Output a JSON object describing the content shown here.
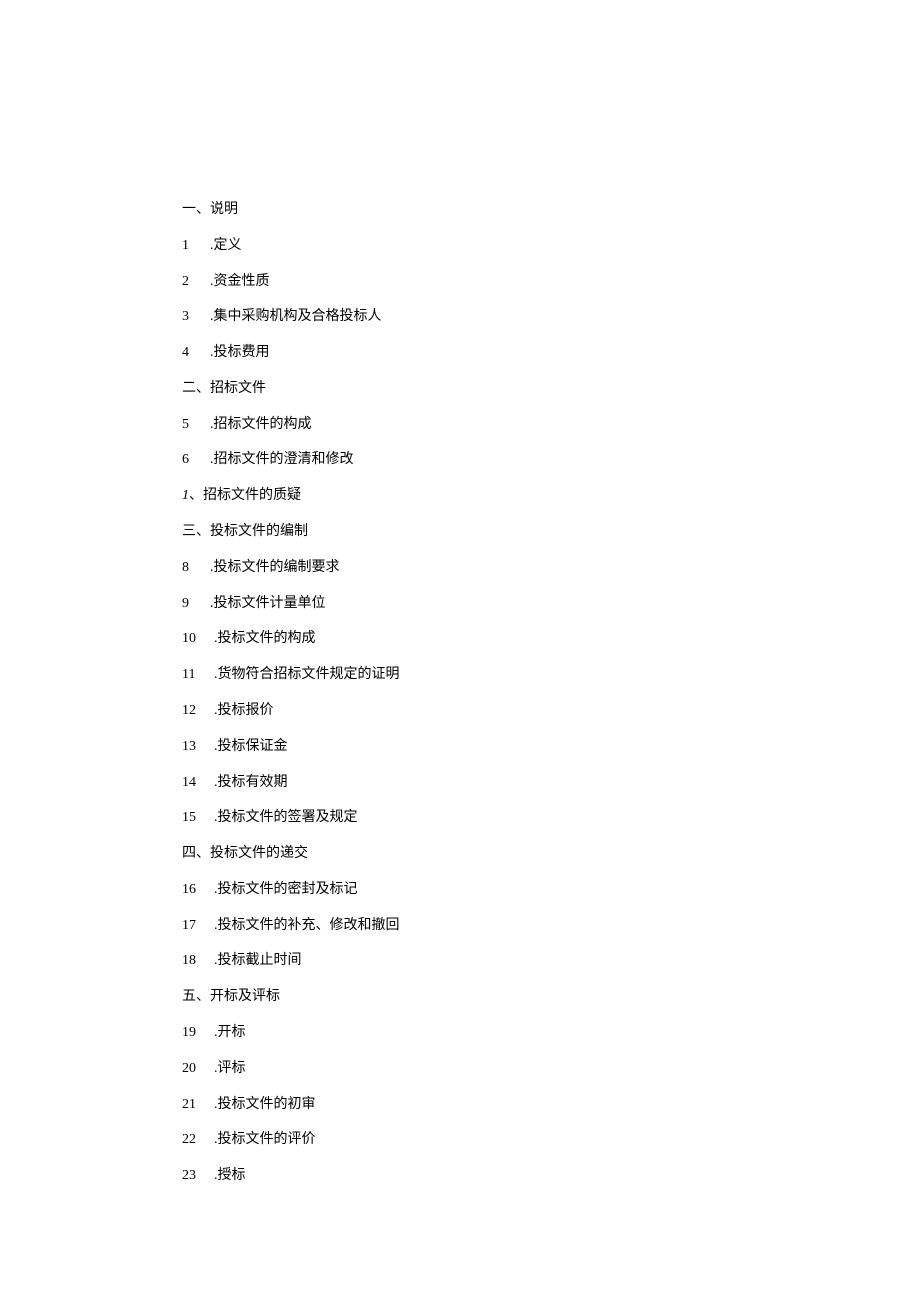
{
  "toc": {
    "sections": [
      {
        "type": "heading",
        "text": "一、说明"
      },
      {
        "type": "item",
        "num": "1",
        "text": ".定义"
      },
      {
        "type": "item",
        "num": "2",
        "text": ".资金性质"
      },
      {
        "type": "item",
        "num": "3",
        "text": ".集中采购机构及合格投标人"
      },
      {
        "type": "item",
        "num": "4",
        "text": ".投标费用"
      },
      {
        "type": "heading",
        "text": "二、招标文件"
      },
      {
        "type": "item",
        "num": "5",
        "text": ".招标文件的构成"
      },
      {
        "type": "item",
        "num": "6",
        "text": ".招标文件的澄清和修改"
      },
      {
        "type": "item-italic",
        "num": "1",
        "sep": "、",
        "text": "招标文件的质疑"
      },
      {
        "type": "heading",
        "text": "三、投标文件的编制"
      },
      {
        "type": "item",
        "num": "8",
        "text": ".投标文件的编制要求"
      },
      {
        "type": "item",
        "num": "9",
        "text": ".投标文件计量单位"
      },
      {
        "type": "item-wide",
        "num": "10",
        "text": ".投标文件的构成"
      },
      {
        "type": "item-wide",
        "num": "11",
        "text": ".货物符合招标文件规定的证明"
      },
      {
        "type": "item-wide",
        "num": "12",
        "text": ".投标报价"
      },
      {
        "type": "item-wide",
        "num": "13",
        "text": ".投标保证金"
      },
      {
        "type": "item-wide",
        "num": "14",
        "text": ".投标有效期"
      },
      {
        "type": "item-wide",
        "num": "15",
        "text": ".投标文件的签署及规定"
      },
      {
        "type": "heading",
        "text": "四、投标文件的递交"
      },
      {
        "type": "item-wide",
        "num": "16",
        "text": ".投标文件的密封及标记"
      },
      {
        "type": "item-wide",
        "num": "17",
        "text": ".投标文件的补充、修改和撤回"
      },
      {
        "type": "item-wide",
        "num": "18",
        "text": ".投标截止时间"
      },
      {
        "type": "heading",
        "text": "五、开标及评标"
      },
      {
        "type": "item-wide",
        "num": "19",
        "text": ".开标"
      },
      {
        "type": "item-wide",
        "num": "20",
        "text": ".评标"
      },
      {
        "type": "item-wide",
        "num": "21",
        "text": ".投标文件的初审"
      },
      {
        "type": "item-wide",
        "num": "22",
        "text": ".投标文件的评价"
      },
      {
        "type": "item-wide",
        "num": "23",
        "text": ".授标"
      }
    ]
  }
}
